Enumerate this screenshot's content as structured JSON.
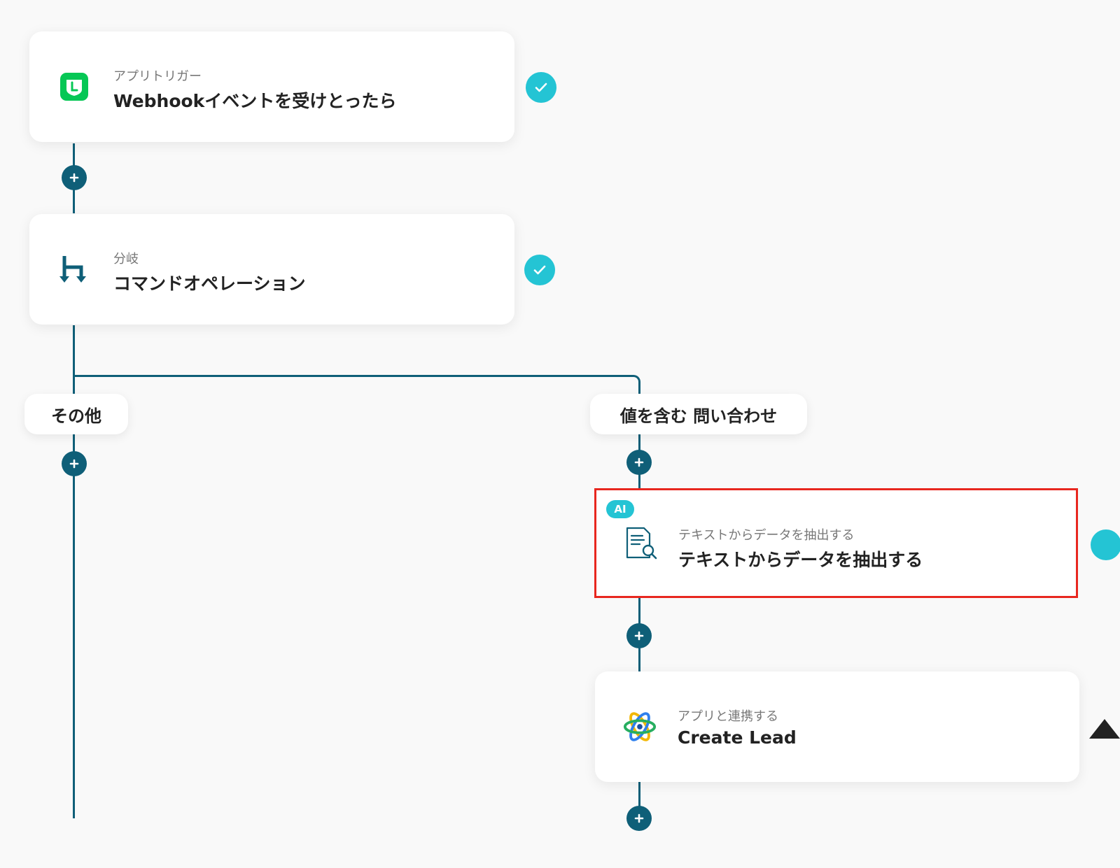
{
  "colors": {
    "accent_teal": "#24c4d4",
    "line_dark": "#0f5f78",
    "highlight_red": "#e8271f",
    "line_app_green": "#06c755"
  },
  "steps": {
    "trigger": {
      "icon": "line-app-icon",
      "subtitle": "アプリトリガー",
      "title": "Webhookイベントを受けとったら",
      "status": "check-icon"
    },
    "branch": {
      "icon": "branch-icon",
      "subtitle": "分岐",
      "title": "コマンドオペレーション",
      "status": "check-icon"
    },
    "extract": {
      "badge": "AI",
      "icon": "document-search-icon",
      "subtitle": "テキストからデータを抽出する",
      "title": "テキストからデータを抽出する"
    },
    "create_lead": {
      "icon": "atom-app-icon",
      "subtitle": "アプリと連携する",
      "title": "Create Lead"
    }
  },
  "branches": {
    "other_label": "その他",
    "contains_label": "値を含む 問い合わせ"
  }
}
